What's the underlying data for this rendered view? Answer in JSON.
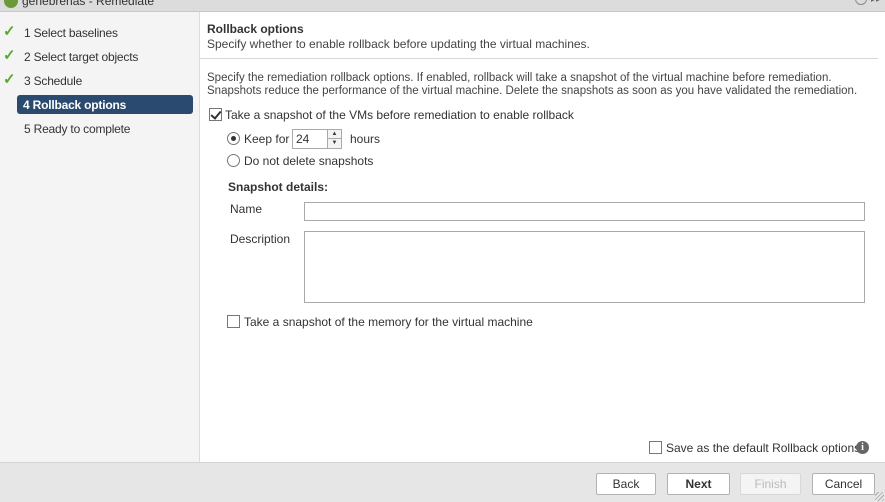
{
  "window": {
    "title": "genebrenas - Remediate",
    "wizard_icon": "wizard-icon",
    "help_icon": "help-icon",
    "expand_icon": "expand-icon"
  },
  "sidebar": {
    "steps": [
      {
        "number": "1",
        "label": "1  Select baselines",
        "completed": true
      },
      {
        "number": "2",
        "label": "2  Select target objects",
        "completed": true
      },
      {
        "number": "3",
        "label": "3  Schedule",
        "completed": true
      },
      {
        "number": "4",
        "label": "4  Rollback options",
        "active": true
      },
      {
        "number": "5",
        "label": "5  Ready to complete",
        "completed": false
      }
    ]
  },
  "main": {
    "title": "Rollback options",
    "subtitle": "Specify whether to enable rollback before updating the virtual machines.",
    "description": "Specify the remediation rollback options. If enabled, rollback will take a snapshot of the virtual machine before remediation. Snapshots reduce the performance of the virtual machine. Delete the snapshots as soon as you have validated the remediation.",
    "enable_snapshot": {
      "label": "Take a snapshot of the VMs before remediation to enable rollback",
      "checked": true
    },
    "keep_for": {
      "label": "Keep for",
      "value": "24",
      "unit": "hours",
      "selected": true
    },
    "do_not_delete": {
      "label": "Do not delete snapshots",
      "selected": false
    },
    "snapshot_details": {
      "heading": "Snapshot details:",
      "name_label": "Name",
      "name_value": "",
      "description_label": "Description",
      "description_value": ""
    },
    "memory_snapshot": {
      "label": "Take a snapshot of the memory for the virtual machine",
      "checked": false
    },
    "save_default": {
      "label": "Save as the default Rollback options",
      "checked": false
    },
    "info_icon": "info-icon"
  },
  "footer": {
    "back": "Back",
    "next": "Next",
    "finish": "Finish",
    "cancel": "Cancel"
  },
  "colors": {
    "active_step": "#2b4a6f",
    "check": "#5aa832"
  }
}
